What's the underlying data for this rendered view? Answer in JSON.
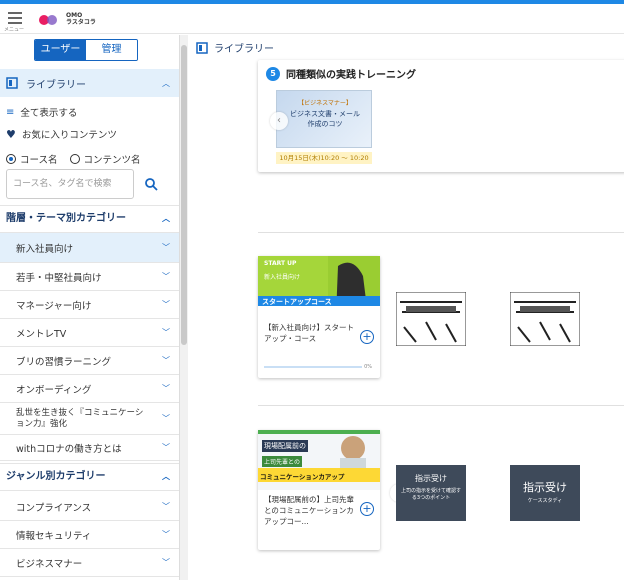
{
  "header": {
    "menu_label": "メニュー",
    "logo_line1": "OMO",
    "logo_line2": "ラスタコラ"
  },
  "sidebar": {
    "role_user": "ユーザー",
    "role_admin": "管理",
    "library_label": "ライブラリー",
    "show_all": "全て表示する",
    "favorites": "お気に入りコンテンツ",
    "radio_course": "コース名",
    "radio_content": "コンテンツ名",
    "search_placeholder": "コース名、タグ名で検索",
    "category_head": "階層・テーマ別カテゴリー",
    "categories": [
      "新入社員向け",
      "若手・中堅社員向け",
      "マネージャー向け",
      "メントレTV",
      "ブリの習慣ラーニング",
      "オンボーディング",
      "乱世を生き抜く『コミュニケーション力』強化",
      "withコロナの働き方とは"
    ],
    "genre_head": "ジャンル別カテゴリー",
    "genres": [
      "コンプライアンス",
      "情報セキュリティ",
      "ビジネスマナー"
    ]
  },
  "main": {
    "title": "ライブラリー",
    "featured": {
      "badge": "5",
      "title": "同種類似の実践トレーニング",
      "thumb_label": "ビジネス文書・メール作成のコツ",
      "thumb_pre": "【ビジネスマナー】",
      "date": "10月15日(木)10:20 〜 10:20"
    },
    "row1": {
      "card_title": "【新入社員向け】スタートアップ・コース",
      "thumb_top": "START UP",
      "thumb_mid": "新入社員向け",
      "thumb_big": "スタートアップコース",
      "pct": "0%"
    },
    "row2": {
      "card_title": "【現場配属前の】上司先輩とのコミュニケーションカアップコー...",
      "thumb_a": "現場配属前の",
      "thumb_b": "上司先輩との",
      "thumb_c": "コミュニケーションカアップ",
      "mini1_title": "指示受け",
      "mini1_sub": "上司の指示を受けて確認する3つのポイント",
      "mini2_title": "指示受け",
      "mini2_sub": "ケーススタディ",
      "pct": "0%"
    }
  }
}
